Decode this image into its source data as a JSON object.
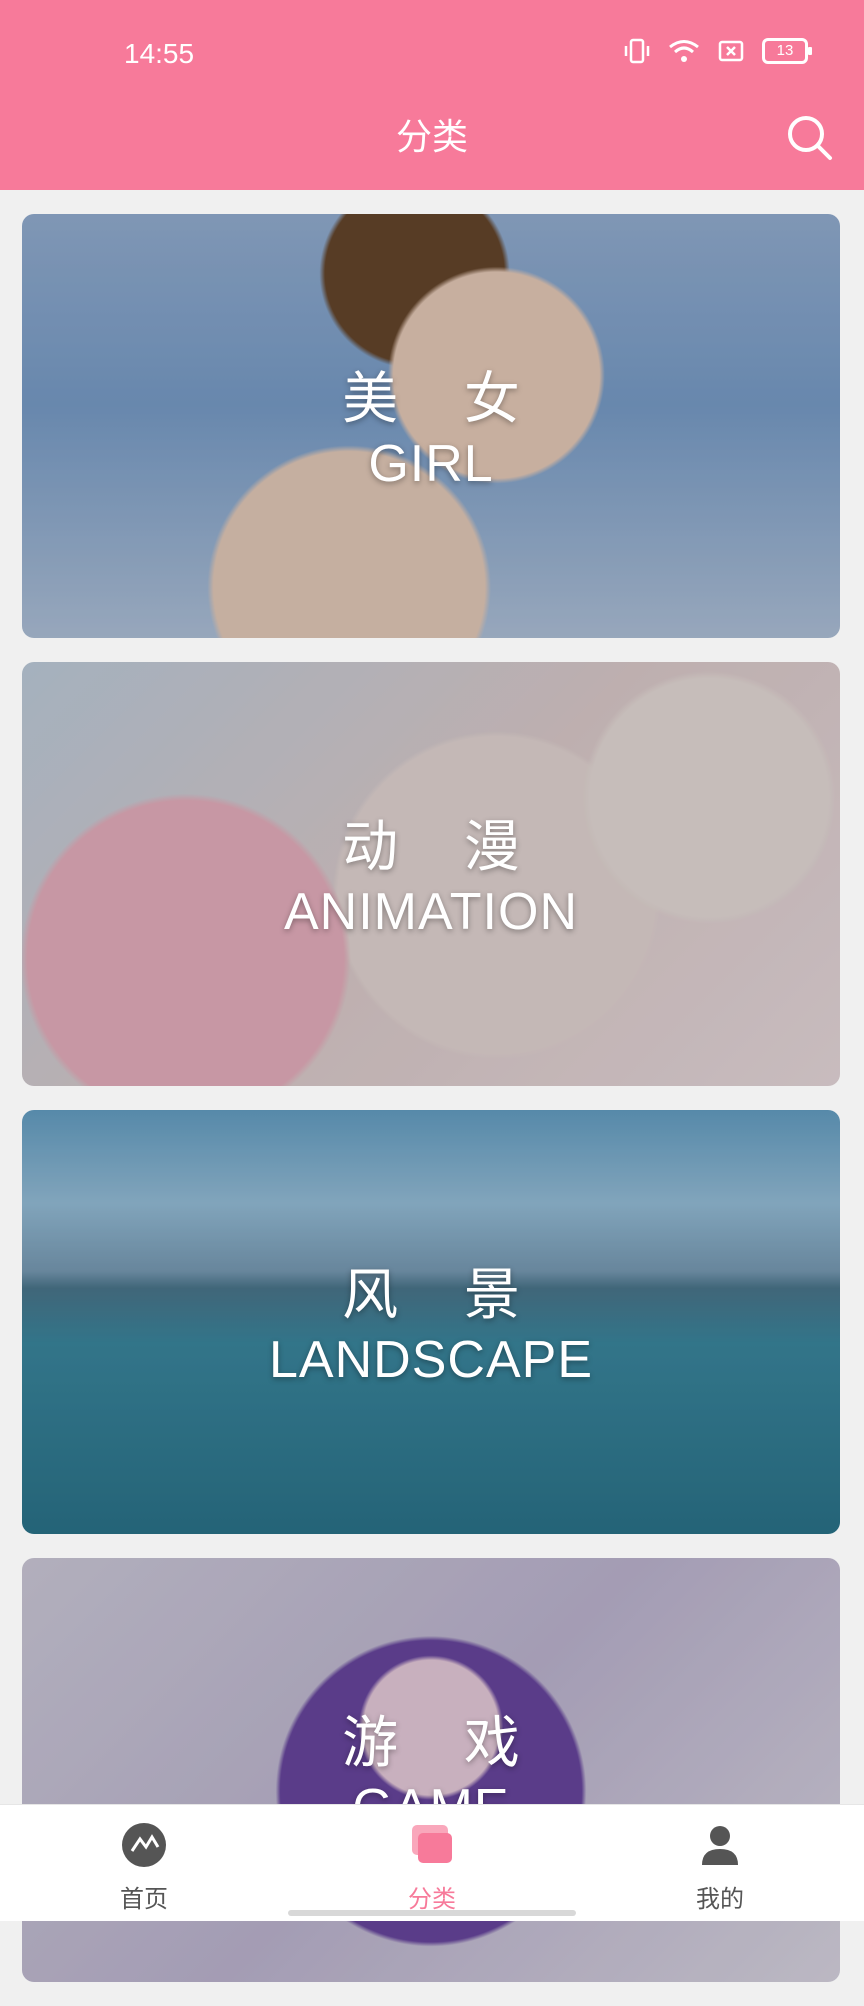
{
  "status_bar": {
    "time": "14:55",
    "battery": "13"
  },
  "header": {
    "title": "分类",
    "search_icon": "search-icon"
  },
  "categories": [
    {
      "cn": "美 女",
      "en": "GIRL"
    },
    {
      "cn": "动 漫",
      "en": "ANIMATION"
    },
    {
      "cn": "风 景",
      "en": "LANDSCAPE"
    },
    {
      "cn": "游 戏",
      "en": "GAME"
    }
  ],
  "bottom_nav": {
    "items": [
      {
        "label": "首页",
        "icon": "home-icon"
      },
      {
        "label": "分类",
        "icon": "category-icon",
        "active": true
      },
      {
        "label": "我的",
        "icon": "profile-icon"
      }
    ]
  },
  "colors": {
    "accent": "#f77a9a"
  }
}
